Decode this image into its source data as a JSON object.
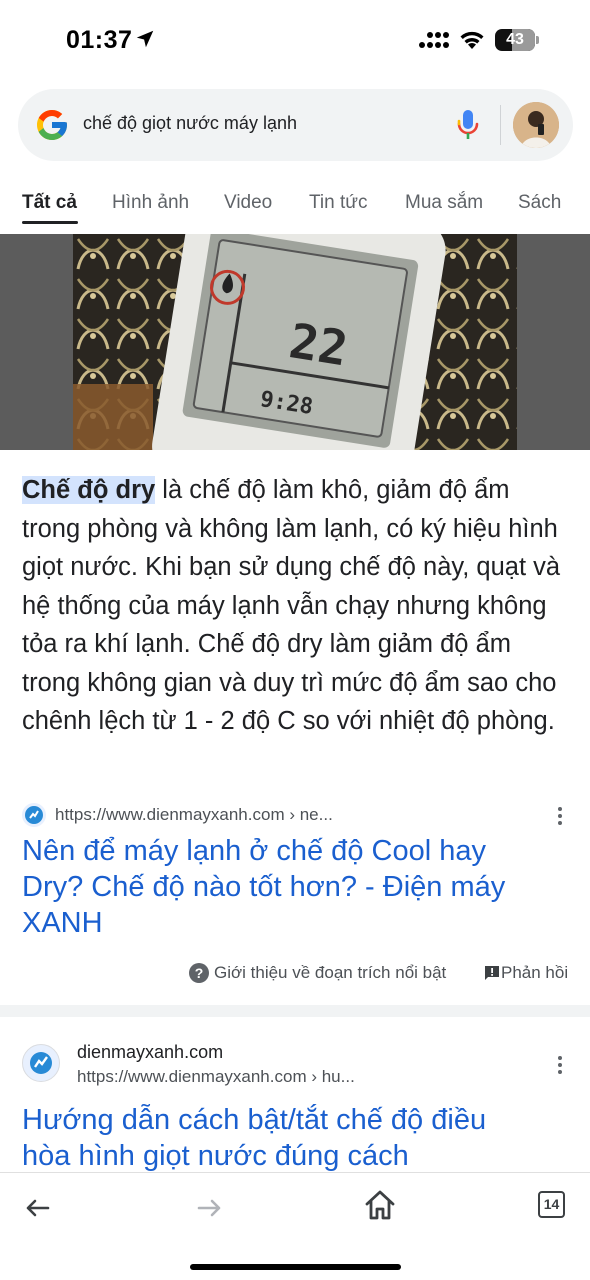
{
  "status_bar": {
    "time": "01:37",
    "battery": "43",
    "battery_level": 0.43
  },
  "search": {
    "query": "chế độ giọt nước máy lạnh"
  },
  "tabs": [
    {
      "label": "Tất cả",
      "active": true
    },
    {
      "label": "Hình ảnh",
      "active": false
    },
    {
      "label": "Video",
      "active": false
    },
    {
      "label": "Tin tức",
      "active": false
    },
    {
      "label": "Mua sắm",
      "active": false
    },
    {
      "label": "Sách",
      "active": false
    }
  ],
  "featured_image": {
    "display_value": "22",
    "display_time": "9:28"
  },
  "snippet": {
    "highlight": "Chế độ dry",
    "text": " là chế độ làm khô, giảm độ ẩm trong phòng và không làm lạnh, có ký hiệu hình giọt nước. Khi bạn sử dụng chế độ này, quạt và hệ thống của máy lạnh vẫn chạy nhưng không tỏa ra khí lạnh. Chế độ dry làm giảm độ ẩm trong không gian và duy trì mức độ ẩm sao cho chênh lệch từ 1 - 2 độ C so với nhiệt độ phòng.",
    "source_url": "https://www.dienmayxanh.com › ne...",
    "title": "Nên để máy lạnh ở chế độ Cool hay Dry? Chế độ nào tốt hơn? - Điện máy XANH",
    "about_label": "Giới thiệu về đoạn trích nổi bật",
    "feedback_label": "Phản hồi"
  },
  "result2": {
    "site_name": "dienmayxanh.com",
    "url": "https://www.dienmayxanh.com › hu...",
    "title_line1": "Hướng dẫn cách bật/tắt chế độ điều",
    "title_line2": "hòa hình giọt nước đúng cách"
  },
  "bottom_nav": {
    "tab_count": "14"
  },
  "colors": {
    "link": "#1a5fcf",
    "highlight": "#d3e3fd",
    "text": "#202124",
    "muted": "#5f6368"
  }
}
